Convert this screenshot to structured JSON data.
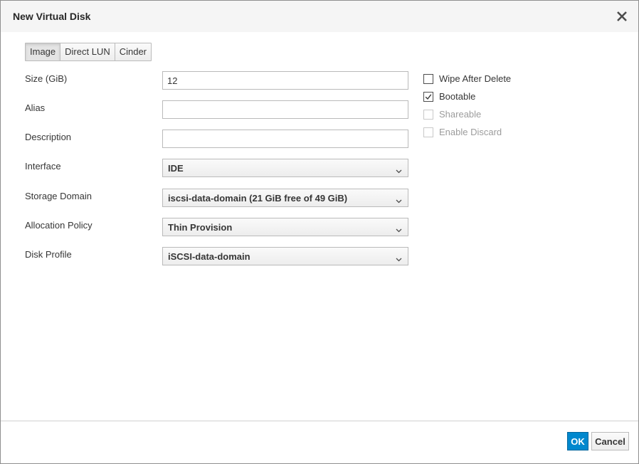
{
  "dialog": {
    "title": "New Virtual Disk",
    "close_icon": "close-icon"
  },
  "tabs": [
    {
      "label": "Image",
      "active": true
    },
    {
      "label": "Direct LUN",
      "active": false
    },
    {
      "label": "Cinder",
      "active": false
    }
  ],
  "form": {
    "size": {
      "label": "Size (GiB)",
      "value": "12"
    },
    "alias": {
      "label": "Alias",
      "value": ""
    },
    "description": {
      "label": "Description",
      "value": ""
    },
    "interface": {
      "label": "Interface",
      "value": "IDE"
    },
    "storage_domain": {
      "label": "Storage Domain",
      "value": "iscsi-data-domain (21 GiB free of 49 GiB)"
    },
    "allocation_policy": {
      "label": "Allocation Policy",
      "value": "Thin Provision"
    },
    "disk_profile": {
      "label": "Disk Profile",
      "value": "iSCSI-data-domain"
    }
  },
  "options": [
    {
      "label": "Wipe After Delete",
      "checked": false,
      "disabled": false
    },
    {
      "label": "Bootable",
      "checked": true,
      "disabled": false
    },
    {
      "label": "Shareable",
      "checked": false,
      "disabled": true
    },
    {
      "label": "Enable Discard",
      "checked": false,
      "disabled": true
    }
  ],
  "buttons": {
    "ok": "OK",
    "cancel": "Cancel"
  },
  "colors": {
    "primary": "#0088ce",
    "header_bg": "#f5f5f5"
  }
}
